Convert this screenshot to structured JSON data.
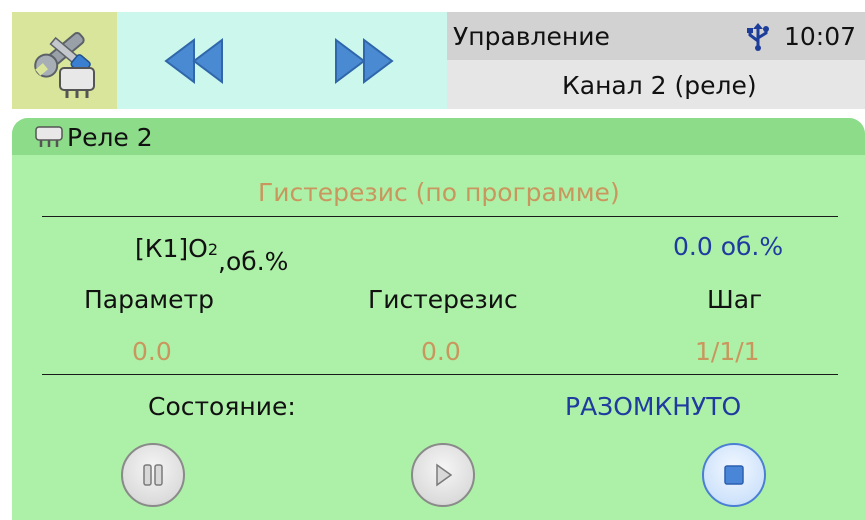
{
  "header": {
    "title": "Управление",
    "time": "10:07",
    "subtitle": "Канал 2 (реле)",
    "icons": {
      "settings": "tools-icon",
      "prev": "rewind-icon",
      "next": "fast-forward-icon",
      "usb": "usb-icon"
    }
  },
  "panel": {
    "title": "Реле 2",
    "title_icon": "relay-icon",
    "mode": "Гистерезис (по программе)",
    "sensor": {
      "prefix": "[К1]О",
      "subscript": "2",
      "unit": ",об.%"
    },
    "sensor_value": "0.0 об.%",
    "columns": {
      "param_label": "Параметр",
      "hyst_label": "Гистерезис",
      "step_label": "Шаг",
      "param_value": "0.0",
      "hyst_value": "0.0",
      "step_value": "1/1/1"
    },
    "state_label": "Состояние:",
    "state_value": "РАЗОМКНУТО"
  },
  "controls": {
    "pause_icon": "pause-icon",
    "play_icon": "play-icon",
    "stop_icon": "stop-icon"
  },
  "colors": {
    "panel_bg": "#adf0a7",
    "panel_header_bg": "#8ddc8a",
    "nav_bg": "#cbf7ec",
    "settings_bg": "#d8e59a",
    "accent_blue": "#1f3ba0",
    "value_orange": "#c9975e",
    "nav_arrow_blue": "#4a8ad2"
  }
}
